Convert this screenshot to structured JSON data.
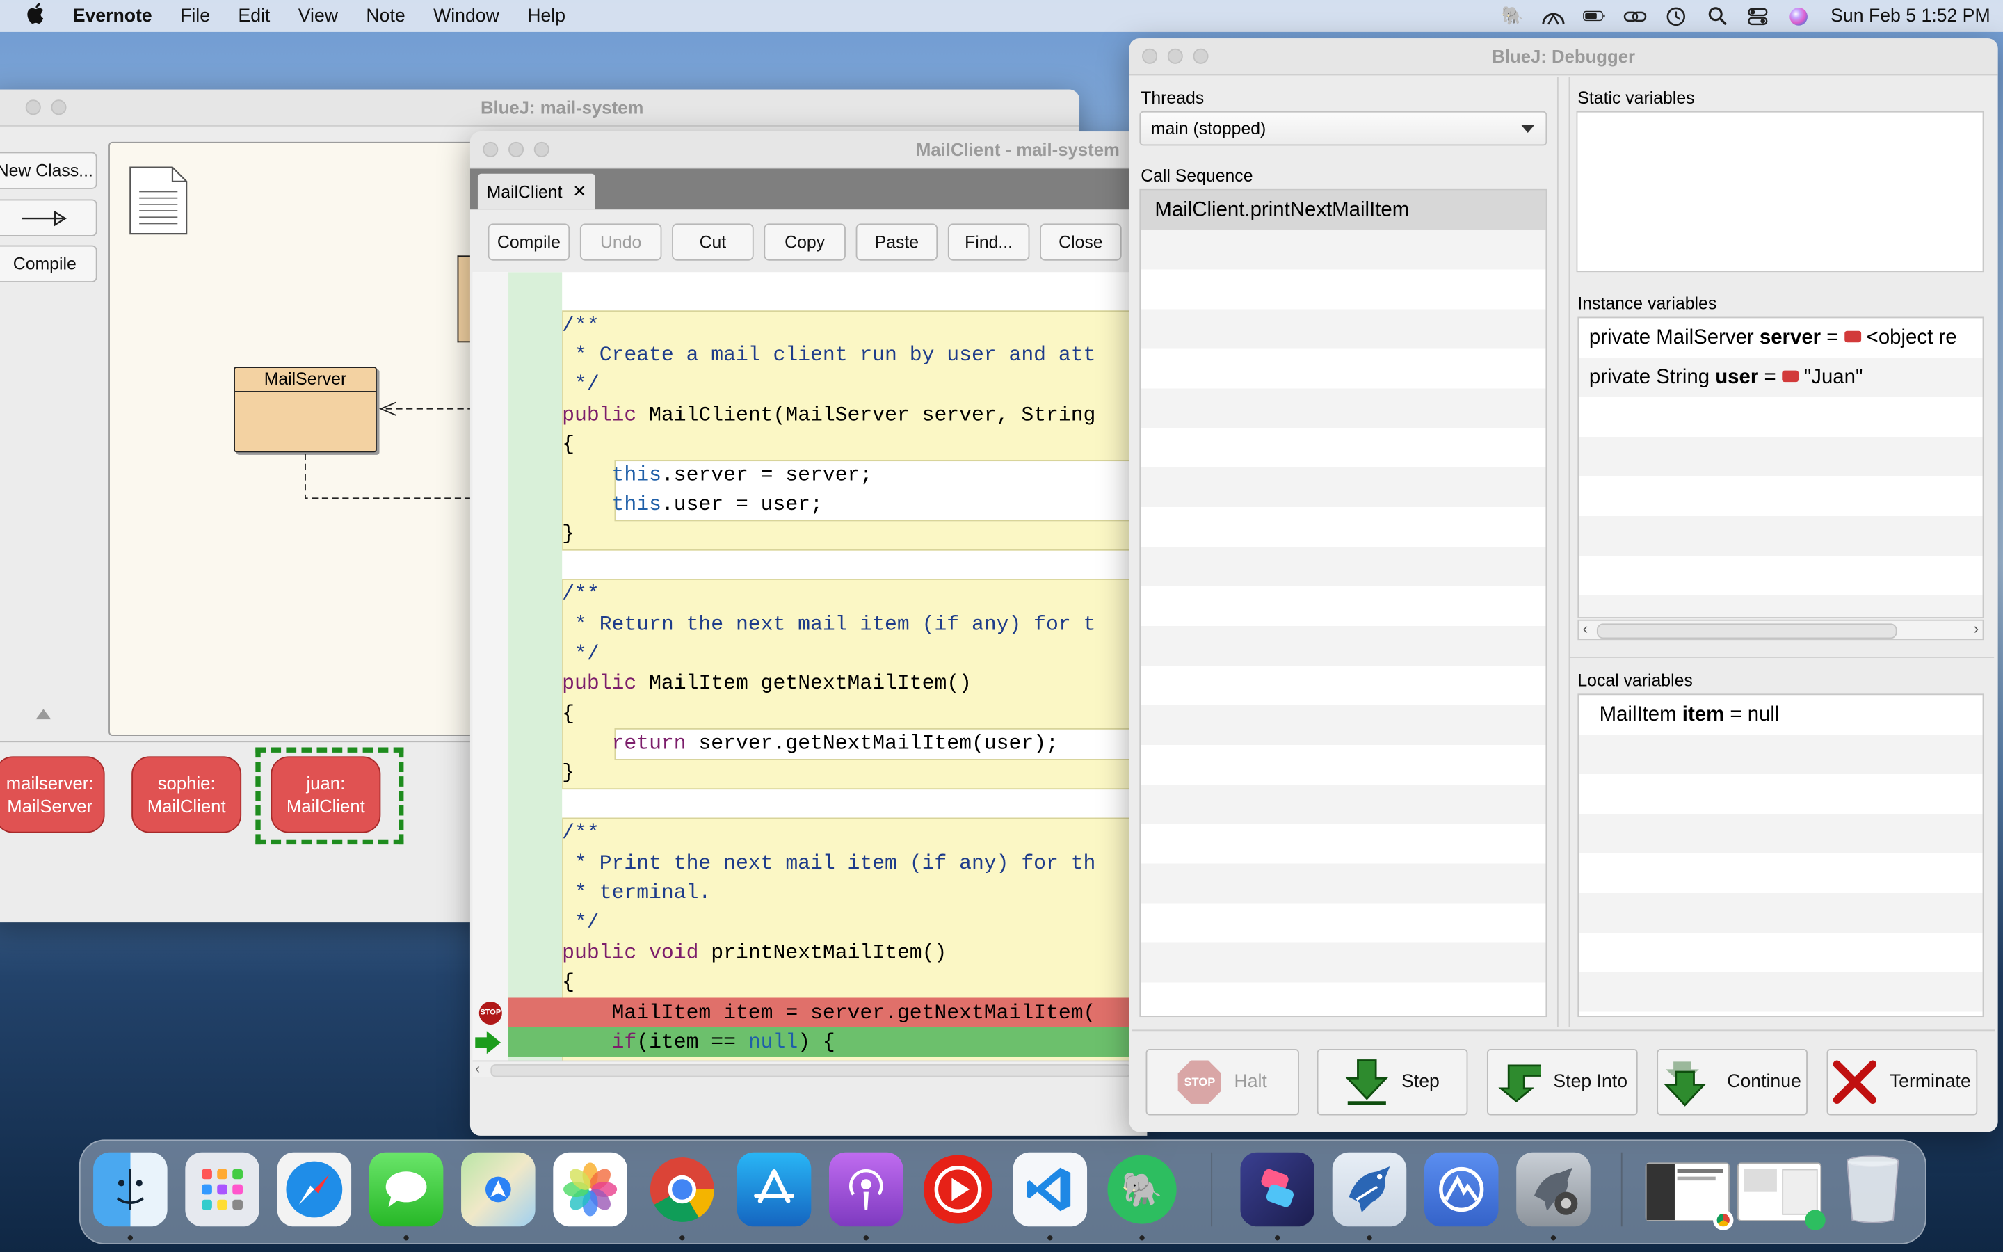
{
  "menubar": {
    "app": "Evernote",
    "items": [
      "File",
      "Edit",
      "View",
      "Note",
      "Window",
      "Help"
    ],
    "datetime": "Sun Feb 5  1:52 PM"
  },
  "bluej_main": {
    "title": "BlueJ:  mail-system",
    "new_class": "New Class...",
    "compile": "Compile",
    "class_mailserver": "MailServer",
    "objects": [
      {
        "line1": "mailserver:",
        "line2": "MailServer"
      },
      {
        "line1": "sophie:",
        "line2": "MailClient"
      },
      {
        "line1": "juan:",
        "line2": "MailClient"
      }
    ]
  },
  "editor": {
    "title": "MailClient - mail-system",
    "tab": "MailClient",
    "toolbar": [
      "Compile",
      "Undo",
      "Cut",
      "Copy",
      "Paste",
      "Find...",
      "Close"
    ],
    "code": [
      "/**",
      " * Create a mail client run by user and att",
      " */",
      "public MailClient(MailServer server, String",
      "{",
      "    this.server = server;",
      "    this.user = user;",
      "}",
      "/**",
      " * Return the next mail item (if any) for t",
      " */",
      "public MailItem getNextMailItem()",
      "{",
      "    return server.getNextMailItem(user);",
      "}",
      "/**",
      " * Print the next mail item (if any) for th",
      " * terminal.",
      " */",
      "public void printNextMailItem()",
      "{",
      "    MailItem item = server.getNextMailItem(",
      "    if(item == null) {"
    ],
    "stop_label": "STOP"
  },
  "debugger": {
    "title": "BlueJ:  Debugger",
    "threads_label": "Threads",
    "thread_selected": "main (stopped)",
    "call_sequence_label": "Call Sequence",
    "call_sequence": [
      "MailClient.printNextMailItem"
    ],
    "static_label": "Static variables",
    "instance_label": "Instance variables",
    "instance_vars": [
      {
        "prefix": "private  MailServer ",
        "name": "server",
        "eq": " = ",
        "value": " <object re"
      },
      {
        "prefix": "private  String ",
        "name": "user",
        "eq": " = ",
        "value": " \"Juan\""
      }
    ],
    "local_label": "Local variables",
    "local_vars": [
      {
        "prefix": "MailItem  ",
        "name": "item",
        "eq": " = ",
        "value": "null"
      }
    ],
    "buttons": {
      "halt": "Halt",
      "step": "Step",
      "step_into": "Step Into",
      "continue": "Continue",
      "terminate": "Terminate"
    },
    "halt_icon_text": "STOP"
  },
  "dock": {
    "apps": [
      "finder-icon",
      "launchpad-icon",
      "safari-icon",
      "messages-icon",
      "maps-icon",
      "photos-icon",
      "chrome-icon",
      "app-store-icon",
      "podcasts-icon",
      "youtube-icon",
      "vscode-icon",
      "evernote-icon",
      "shortcuts-icon",
      "bluej-icon",
      "nordvpn-icon",
      "bluej-debug-icon",
      "window-thumbnail-1",
      "window-thumbnail-2",
      "trash-icon"
    ]
  }
}
